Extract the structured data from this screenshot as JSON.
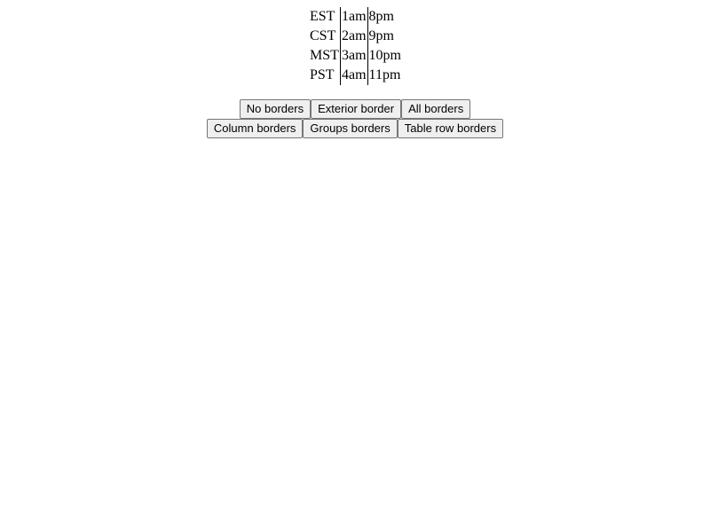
{
  "timezone_table": {
    "rows": [
      {
        "zone": "EST",
        "first": "1am",
        "second": "8pm"
      },
      {
        "zone": "CST",
        "first": "2am",
        "second": "9pm"
      },
      {
        "zone": "MST",
        "first": "3am",
        "second": "10pm"
      },
      {
        "zone": "PST",
        "first": "4am",
        "second": "11pm"
      }
    ]
  },
  "border_buttons": {
    "no_borders": "No borders",
    "exterior_border": "Exterior border",
    "all_borders": "All borders",
    "column_borders": "Column borders",
    "groups_borders": "Groups borders",
    "table_row_borders": "Table row borders"
  },
  "colors": {
    "background": "#ffffff",
    "text": "#000000",
    "button_face": "#efefef",
    "button_border": "#767676",
    "column_rule": "#000000"
  }
}
